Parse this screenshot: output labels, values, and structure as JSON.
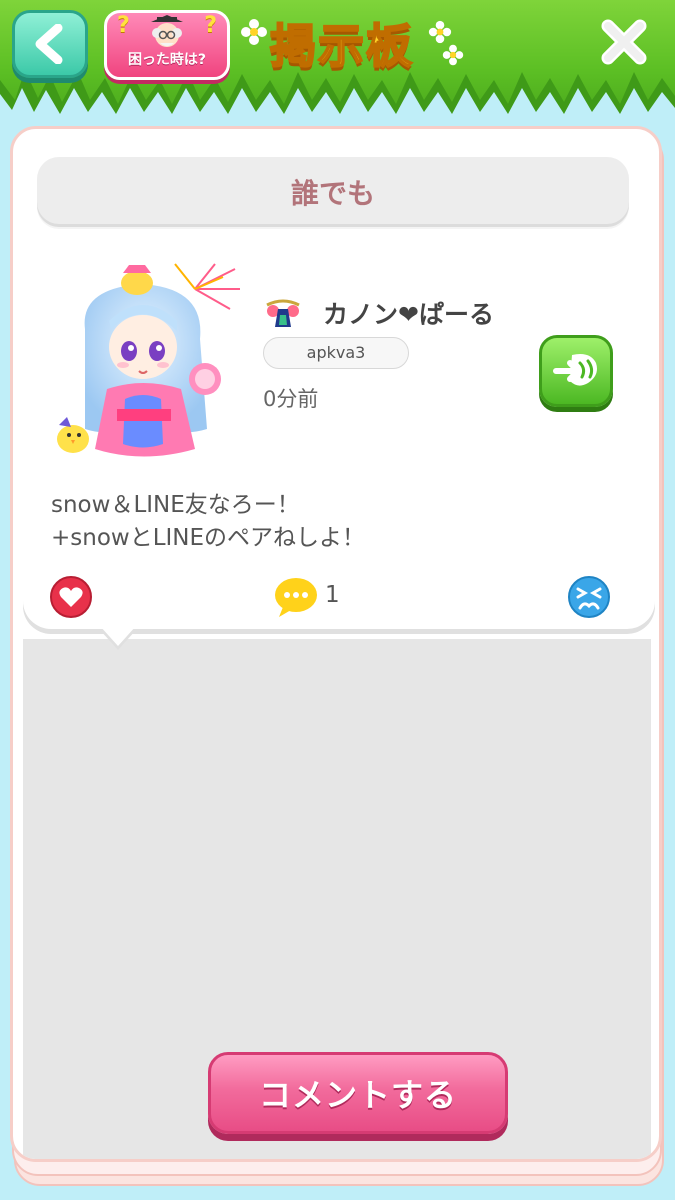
{
  "header": {
    "title": "掲示板",
    "help_label": "困った時は?",
    "back_icon": "chevron-left-icon",
    "close_icon": "close-icon"
  },
  "filter": {
    "label": "誰でも"
  },
  "post": {
    "user_name": "カノン❤ぱーる",
    "user_id": "apkva3",
    "time": "0分前",
    "body_line1": "snow＆LINE友なろー！",
    "body_line2": "+snowとLINEのペアねしよ！",
    "comment_count": "1"
  },
  "actions": {
    "comment_button": "コメントする"
  },
  "colors": {
    "accent_pink": "#f26b9c",
    "accent_green": "#5cbf24",
    "title_yellow": "#ffd428"
  }
}
